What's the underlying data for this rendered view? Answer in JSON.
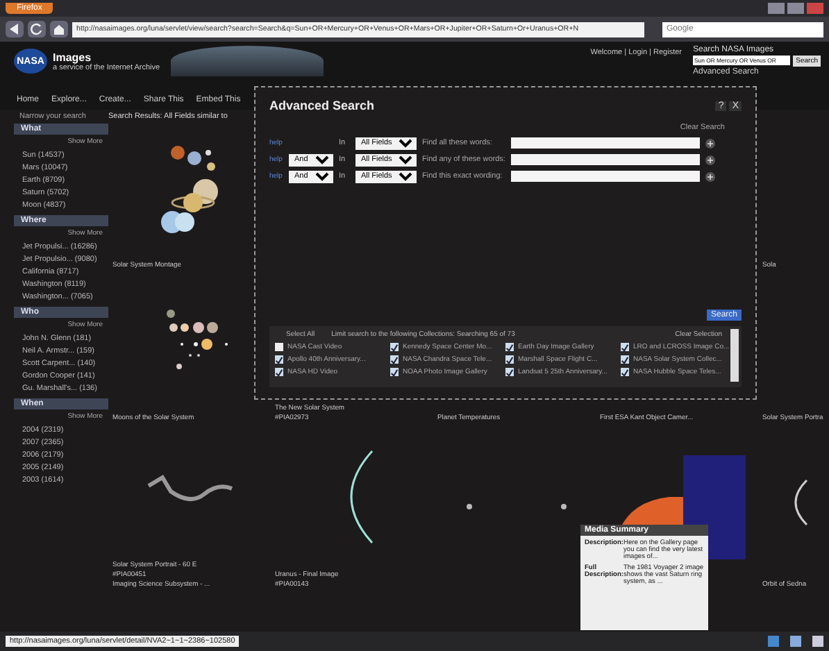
{
  "browser": {
    "tab": "Firefox",
    "url": "http://nasaimages.org/luna/servlet/view/search?search=Search&q=Sun+OR+Mercury+OR+Venus+OR+Mars+OR+Jupiter+OR+Saturn+Or+Uranus+OR+N",
    "search_placeholder": "Google"
  },
  "header": {
    "logo": "NASA",
    "title": "Images",
    "subtitle": "a service of the Internet Archive",
    "account": "Welcome | Login | Register",
    "search_label": "Search NASA Images",
    "search_value": "Sun OR Mercury OR Venus OR",
    "search_button": "Search",
    "advanced_link": "Advanced Search"
  },
  "nav": [
    "Home",
    "Explore...",
    "Create...",
    "Share This",
    "Embed This"
  ],
  "sidebar": {
    "title": "Narrow your search",
    "facets": [
      {
        "heading": "What",
        "show_more": "Show More",
        "items": [
          "Sun (14537)",
          "Mars (10047)",
          "Earth (8709)",
          "Saturn (5702)",
          "Moon (4837)"
        ]
      },
      {
        "heading": "Where",
        "show_more": "Show More",
        "items": [
          "Jet Propulsi... (16286)",
          "Jet Propulsio... (9080)",
          "California (8717)",
          "Washington (8119)",
          "Washington... (7065)"
        ]
      },
      {
        "heading": "Who",
        "show_more": "Show More",
        "items": [
          "John N. Glenn (181)",
          "Neil A. Armstr... (159)",
          "Scott Carpent... (140)",
          "Gordon Cooper (141)",
          "Gu. Marshall's... (136)"
        ]
      },
      {
        "heading": "When",
        "show_more": "Show More",
        "items": [
          "2004 (2319)",
          "2007 (2365)",
          "2006 (2179)",
          "2005 (2149)",
          "2003 (1614)"
        ]
      }
    ]
  },
  "results": {
    "heading": "Search Results: All Fields similar to",
    "items": [
      {
        "kind": "planets",
        "lines": [
          "Solar System Montage"
        ]
      },
      {
        "kind": "none"
      },
      {
        "kind": "none"
      },
      {
        "kind": "none"
      },
      {
        "kind": "none",
        "lines": [
          "Sola"
        ]
      },
      {
        "kind": "moons",
        "lines": [
          "Moons of the Solar System"
        ]
      },
      {
        "kind": "none",
        "lines": [
          "The New Solar System",
          "#PIA02973"
        ]
      },
      {
        "kind": "thermometer",
        "lines": [
          "Planet Temperatures"
        ]
      },
      {
        "kind": "none",
        "lines": [
          "First ESA Kant Object Camer..."
        ]
      },
      {
        "kind": "none",
        "lines": [
          "Solar System Portra"
        ]
      },
      {
        "kind": "squiggle",
        "lines": [
          "Solar System Portrait - 60 E",
          "#PIA00451",
          "Imaging Science Subsystem - ..."
        ]
      },
      {
        "kind": "arc",
        "lines": [
          "Uranus - Final Image",
          "#PIA00143"
        ]
      },
      {
        "kind": "stars"
      },
      {
        "kind": "saturn"
      },
      {
        "kind": "orbit",
        "lines": [
          "Orbit of Sedna"
        ]
      }
    ]
  },
  "advanced_search": {
    "title": "Advanced Search",
    "help": "?",
    "close": "X",
    "clear": "Clear Search",
    "rows": [
      {
        "help": "help",
        "in_label": "In",
        "field": "All Fields",
        "label": "Find all these words:"
      },
      {
        "help": "help",
        "operator": "And",
        "in_label": "In",
        "field": "All Fields",
        "label": "Find any of these words:"
      },
      {
        "help": "help",
        "operator": "And",
        "in_label": "In",
        "field": "All Fields",
        "label": "Find this exact wording:"
      }
    ],
    "search_button": "Search",
    "collections": {
      "select_all": "Select All",
      "limit": "Limit search to the following Collections: Searching 65 of 73",
      "clear": "Clear Selection",
      "items": [
        {
          "label": "NASA Cast Video",
          "checked": false
        },
        {
          "label": "Kennedy Space Center Mo...",
          "checked": true
        },
        {
          "label": "Earth Day Image Gallery",
          "checked": true
        },
        {
          "label": "LRO and LCROSS Image Co...",
          "checked": true
        },
        {
          "label": "Apollo 40th Anniversary...",
          "checked": true
        },
        {
          "label": "NASA Chandra Space Tele...",
          "checked": true
        },
        {
          "label": "Marshall Space Flight C...",
          "checked": true
        },
        {
          "label": "NASA Solar System Collec...",
          "checked": true
        },
        {
          "label": "NASA HD Video",
          "checked": true
        },
        {
          "label": "NOAA Photo Image Gallery",
          "checked": true
        },
        {
          "label": "Landsat 5 25th Anniversary...",
          "checked": true
        },
        {
          "label": "NASA Hubble Space Teles...",
          "checked": true
        }
      ]
    }
  },
  "media_summary": {
    "title": "Media Summary",
    "entries": [
      {
        "label": "Description:",
        "text": "Here on the Gallery page you can find the very latest images of..."
      },
      {
        "label": "Full Description:",
        "text": "The 1981 Voyager 2 image shows the vast Saturn ring system, as ..."
      }
    ]
  },
  "status_bar": {
    "url": "http://nasaimages.org/luna/servlet/detail/NVA2~1~1~2386~102580"
  }
}
